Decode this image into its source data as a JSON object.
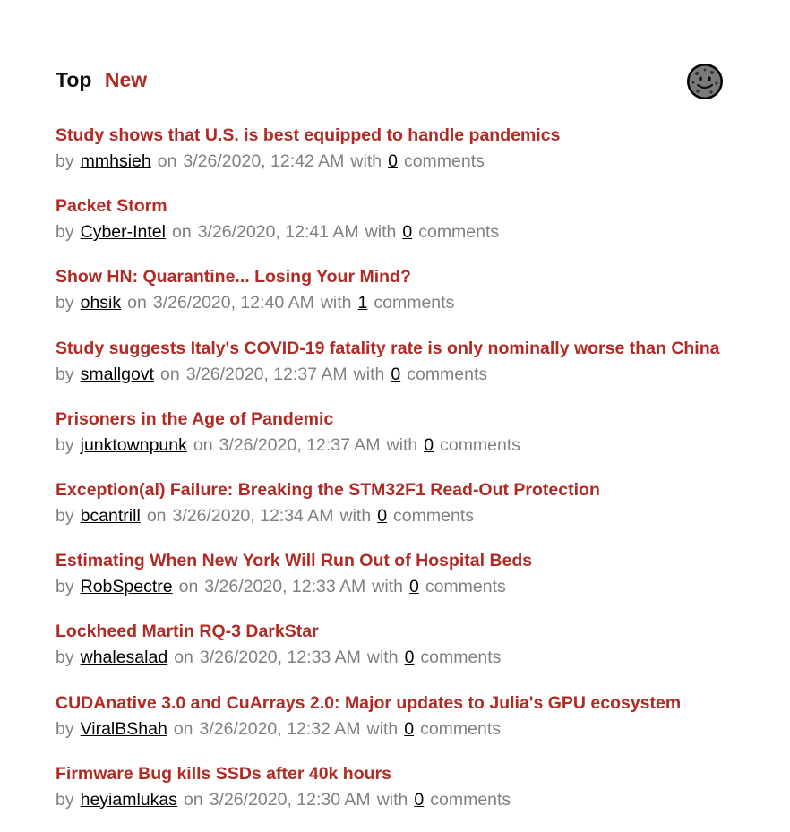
{
  "header": {
    "tab_top": "Top",
    "tab_new": "New",
    "avatar_icon": "cookie-face-icon"
  },
  "colors": {
    "accent": "#b22a24",
    "text": "#111111",
    "muted": "#808080"
  },
  "meta_words": {
    "by": "by",
    "on": "on",
    "with": "with",
    "comments": "comments"
  },
  "items": [
    {
      "title": "Study shows that U.S. is best equipped to handle pandemics",
      "author": "mmhsieh",
      "date": "3/26/2020, 12:42 AM",
      "comments": "0"
    },
    {
      "title": "Packet Storm",
      "author": "Cyber-Intel",
      "date": "3/26/2020, 12:41 AM",
      "comments": "0"
    },
    {
      "title": "Show HN: Quarantine... Losing Your Mind?",
      "author": "ohsik",
      "date": "3/26/2020, 12:40 AM",
      "comments": "1"
    },
    {
      "title": "Study suggests Italy's COVID-19 fatality rate is only nominally worse than China",
      "author": "smallgovt",
      "date": "3/26/2020, 12:37 AM",
      "comments": "0"
    },
    {
      "title": "Prisoners in the Age of Pandemic",
      "author": "junktownpunk",
      "date": "3/26/2020, 12:37 AM",
      "comments": "0"
    },
    {
      "title": "Exception(al) Failure: Breaking the STM32F1 Read-Out Protection",
      "author": "bcantrill",
      "date": "3/26/2020, 12:34 AM",
      "comments": "0"
    },
    {
      "title": "Estimating When New York Will Run Out of Hospital Beds",
      "author": "RobSpectre",
      "date": "3/26/2020, 12:33 AM",
      "comments": "0"
    },
    {
      "title": "Lockheed Martin RQ-3 DarkStar",
      "author": "whalesalad",
      "date": "3/26/2020, 12:33 AM",
      "comments": "0"
    },
    {
      "title": "CUDAnative 3.0 and CuArrays 2.0: Major updates to Julia's GPU ecosystem",
      "author": "ViralBShah",
      "date": "3/26/2020, 12:32 AM",
      "comments": "0"
    },
    {
      "title": "Firmware Bug kills SSDs after 40k hours",
      "author": "heyiamlukas",
      "date": "3/26/2020, 12:30 AM",
      "comments": "0"
    }
  ]
}
